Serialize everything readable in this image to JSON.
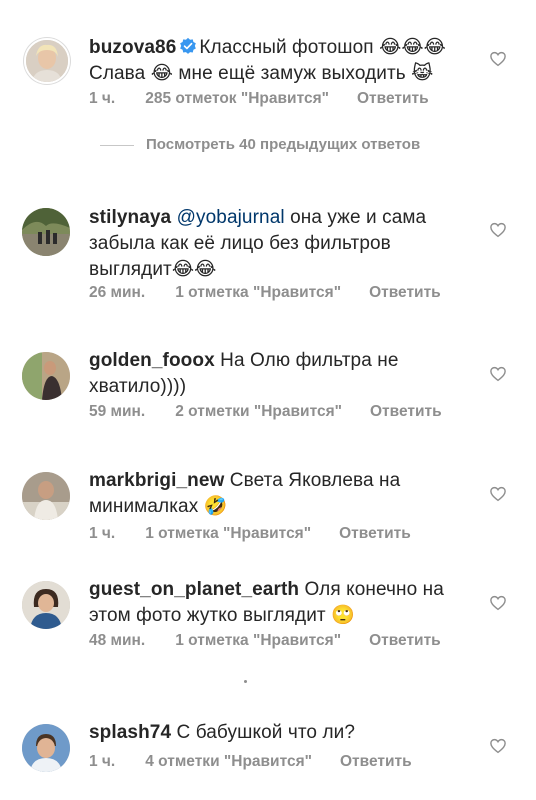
{
  "main_comment": {
    "username": "buzova86",
    "text_line1": "Классный фотошоп 😂😂😂",
    "text_line2": "Слава 😂 мне ещё замуж выходить 😹",
    "time": "1 ч.",
    "likes": "285 отметок \"Нравится\"",
    "reply": "Ответить"
  },
  "view_previous_replies": "Посмотреть 40 предыдущих ответов",
  "replies": [
    {
      "username": "stilynaya",
      "mention": "@yobajurnal",
      "text_line1": " она уже и сама",
      "text_line2": "забыла как её лицо без фильтров",
      "text_line3": "выглядит😂😂",
      "time": "26 мин.",
      "likes": "1 отметка \"Нравится\"",
      "reply": "Ответить"
    },
    {
      "username": "golden_fooox",
      "text_line1": " На Олю фильтра не",
      "text_line2": "хватило))))",
      "time": "59 мин.",
      "likes": "2 отметки \"Нравится\"",
      "reply": "Ответить"
    },
    {
      "username": "markbrigi_new",
      "text_line1": " Света Яковлева на",
      "text_line2": "минималках 🤣",
      "time": "1 ч.",
      "likes": "1 отметка \"Нравится\"",
      "reply": "Ответить"
    },
    {
      "username": "guest_on_planet_earth",
      "text_line1": " Оля конечно на",
      "text_line2": "этом фото жутко выглядит 🙄",
      "time": "48 мин.",
      "likes": "1 отметка \"Нравится\"",
      "reply": "Ответить"
    },
    {
      "username": "splash74",
      "text_line1": " С бабушкой что ли?",
      "time": "1 ч.",
      "likes": "4 отметки \"Нравится\"",
      "reply": "Ответить"
    }
  ],
  "icons": {
    "like": "heart-outline-icon",
    "verified": "verified-badge-icon"
  },
  "colors": {
    "text": "#262626",
    "secondary": "#8e8e8e",
    "mention": "#00376b",
    "verified": "#3897f0"
  }
}
